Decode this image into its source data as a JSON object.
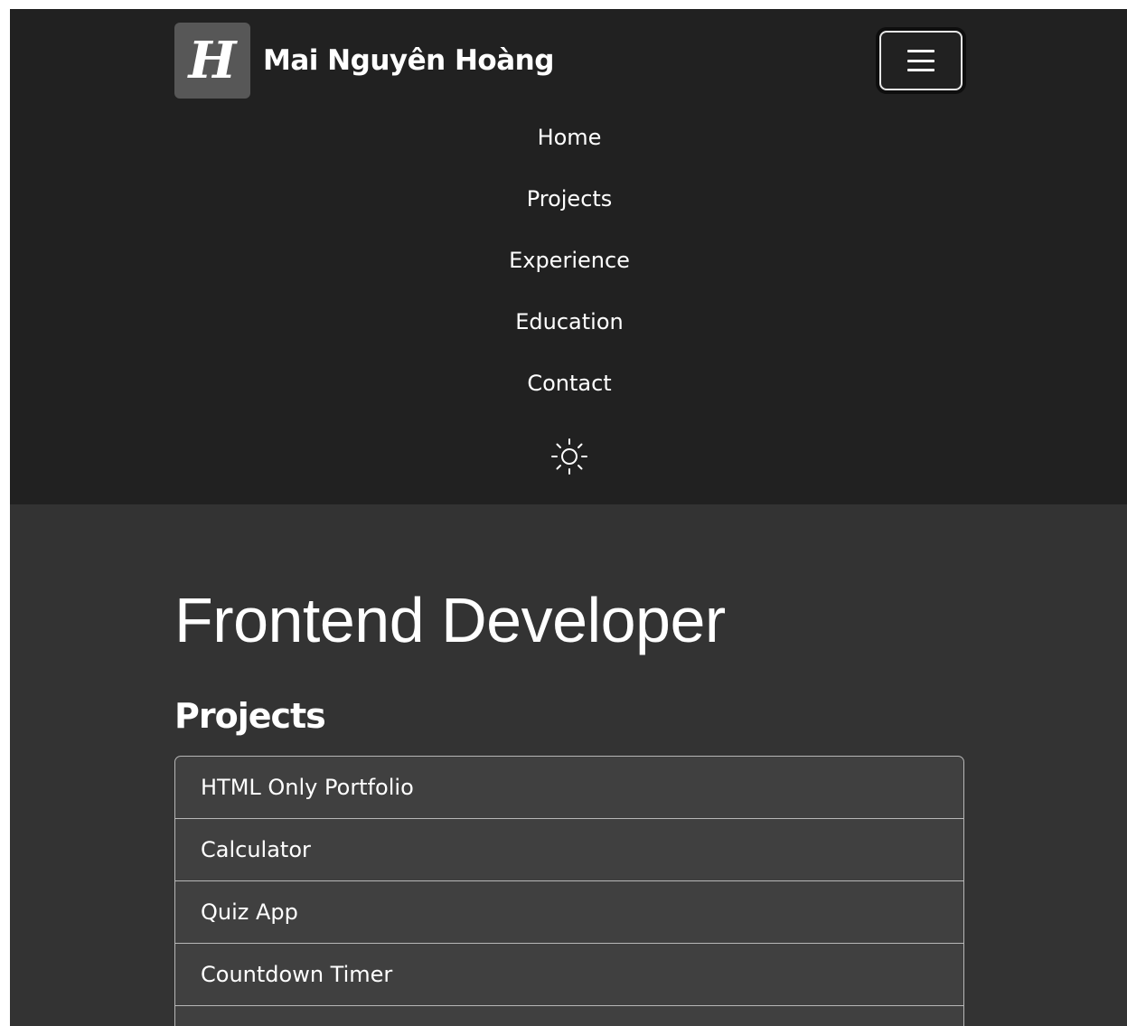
{
  "brand": {
    "logo_letter": "H",
    "name": "Mai Nguyên Hoàng"
  },
  "navbar": {
    "toggler_icon": "hamburger-menu-icon",
    "links": [
      "Home",
      "Projects",
      "Experience",
      "Education",
      "Contact"
    ],
    "theme_toggle_icon": "sun-icon"
  },
  "hero": {
    "title": "Frontend Developer"
  },
  "projects": {
    "heading": "Projects",
    "items": [
      "HTML Only Portfolio",
      "Calculator",
      "Quiz App",
      "Countdown Timer",
      ""
    ]
  },
  "colors": {
    "navbar_bg": "#212121",
    "page_bg": "#333333",
    "list_item_bg": "#404040",
    "logo_bg": "#575757",
    "text": "#ffffff",
    "border": "#b7b7b7"
  }
}
